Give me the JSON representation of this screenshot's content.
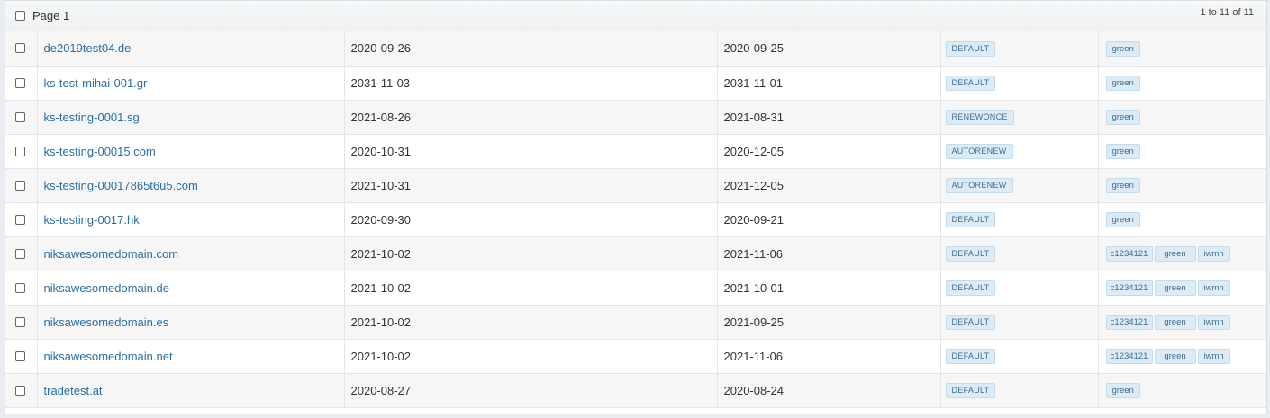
{
  "header": {
    "page_label": "Page 1",
    "range_text": "1 to 11 of 11"
  },
  "rows": [
    {
      "domain": "de2019test04.de",
      "date1": "2020-09-26",
      "date2": "2020-09-25",
      "renewal": "DEFAULT",
      "tags": [
        "green"
      ]
    },
    {
      "domain": "ks-test-mihai-001.gr",
      "date1": "2031-11-03",
      "date2": "2031-11-01",
      "renewal": "DEFAULT",
      "tags": [
        "green"
      ]
    },
    {
      "domain": "ks-testing-0001.sg",
      "date1": "2021-08-26",
      "date2": "2021-08-31",
      "renewal": "RENEWONCE",
      "tags": [
        "green"
      ]
    },
    {
      "domain": "ks-testing-00015.com",
      "date1": "2020-10-31",
      "date2": "2020-12-05",
      "renewal": "AUTORENEW",
      "tags": [
        "green"
      ]
    },
    {
      "domain": "ks-testing-00017865t6u5.com",
      "date1": "2021-10-31",
      "date2": "2021-12-05",
      "renewal": "AUTORENEW",
      "tags": [
        "green"
      ]
    },
    {
      "domain": "ks-testing-0017.hk",
      "date1": "2020-09-30",
      "date2": "2020-09-21",
      "renewal": "DEFAULT",
      "tags": [
        "green"
      ]
    },
    {
      "domain": "niksawesomedomain.com",
      "date1": "2021-10-02",
      "date2": "2021-11-06",
      "renewal": "DEFAULT",
      "tags": [
        "c1234121",
        "green",
        "iwmn"
      ]
    },
    {
      "domain": "niksawesomedomain.de",
      "date1": "2021-10-02",
      "date2": "2021-10-01",
      "renewal": "DEFAULT",
      "tags": [
        "c1234121",
        "green",
        "iwmn"
      ]
    },
    {
      "domain": "niksawesomedomain.es",
      "date1": "2021-10-02",
      "date2": "2021-09-25",
      "renewal": "DEFAULT",
      "tags": [
        "c1234121",
        "green",
        "iwmn"
      ]
    },
    {
      "domain": "niksawesomedomain.net",
      "date1": "2021-10-02",
      "date2": "2021-11-06",
      "renewal": "DEFAULT",
      "tags": [
        "c1234121",
        "green",
        "iwmn"
      ]
    },
    {
      "domain": "tradetest.at",
      "date1": "2020-08-27",
      "date2": "2020-08-24",
      "renewal": "DEFAULT",
      "tags": [
        "green"
      ]
    }
  ]
}
